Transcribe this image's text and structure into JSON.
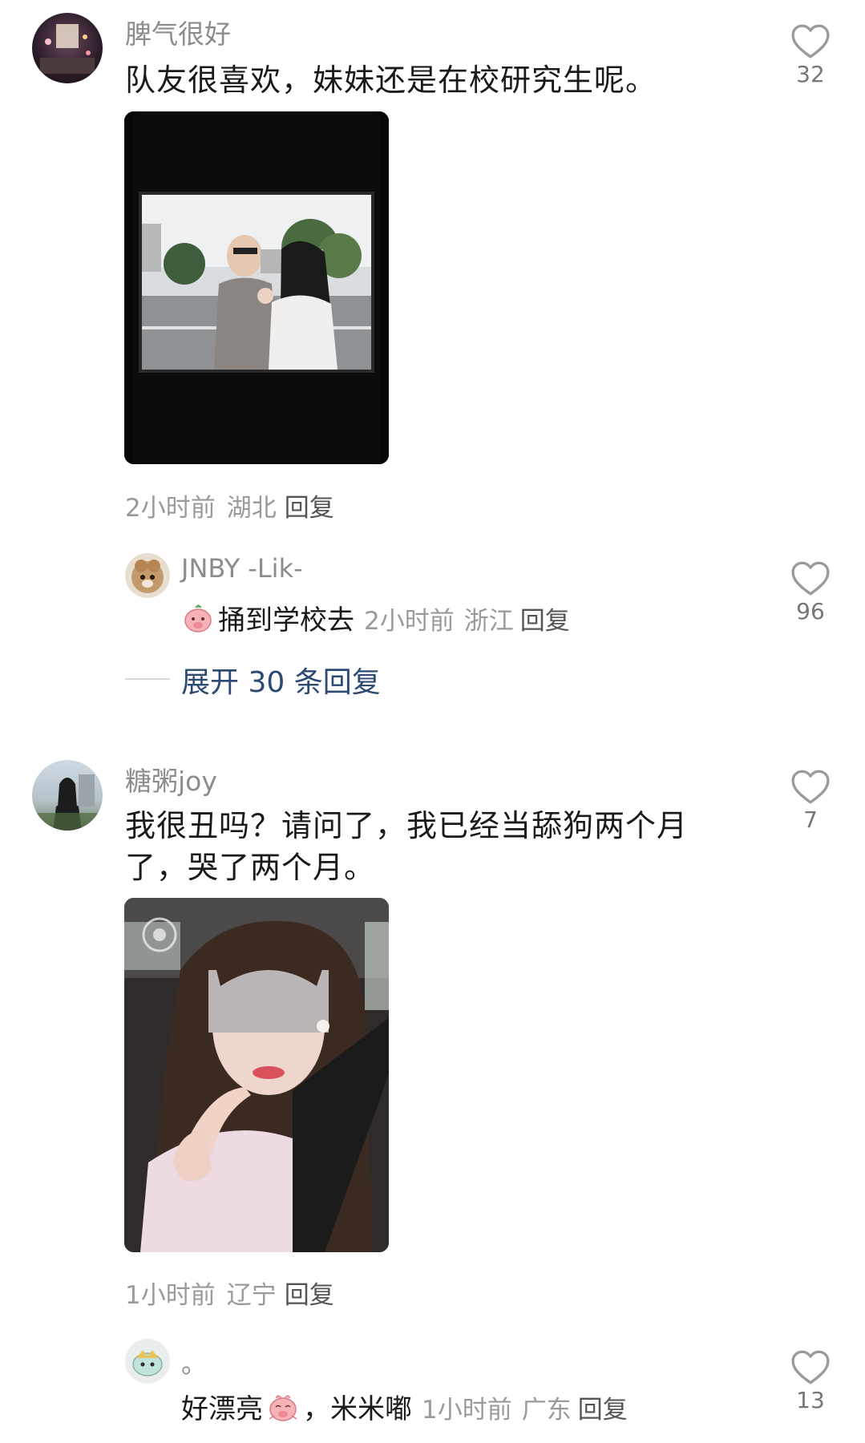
{
  "comments": [
    {
      "username": "脾气很好",
      "text": "队友很喜欢，妹妹还是在校研究生呢。",
      "time": "2小时前",
      "location": "湖北",
      "reply_label": "回复",
      "likes": "32",
      "replies": [
        {
          "username": "JNBY -Lik-",
          "text": "捅到学校去",
          "time": "2小时前",
          "location": "浙江",
          "reply_label": "回复",
          "likes": "96"
        }
      ],
      "expand_label": "展开 30 条回复"
    },
    {
      "username": "糖粥joy",
      "text_line1": "我很丑吗？请问了，我已经当舔狗两个月",
      "text_line2": "了，哭了两个月。",
      "time": "1小时前",
      "location": "辽宁",
      "reply_label": "回复",
      "likes": "7",
      "replies": [
        {
          "username": "。",
          "text_before": "好漂亮",
          "text_after": "，米米嘟",
          "time": "1小时前",
          "location": "广东",
          "reply_label": "回复",
          "likes": "13"
        }
      ]
    }
  ],
  "icons": {
    "like": "heart-outline-icon",
    "emoji": "pig-face-emoji-icon"
  },
  "colors": {
    "username": "#8c8c8c",
    "meta": "#9a9a9a",
    "expand": "#2d4a73"
  }
}
